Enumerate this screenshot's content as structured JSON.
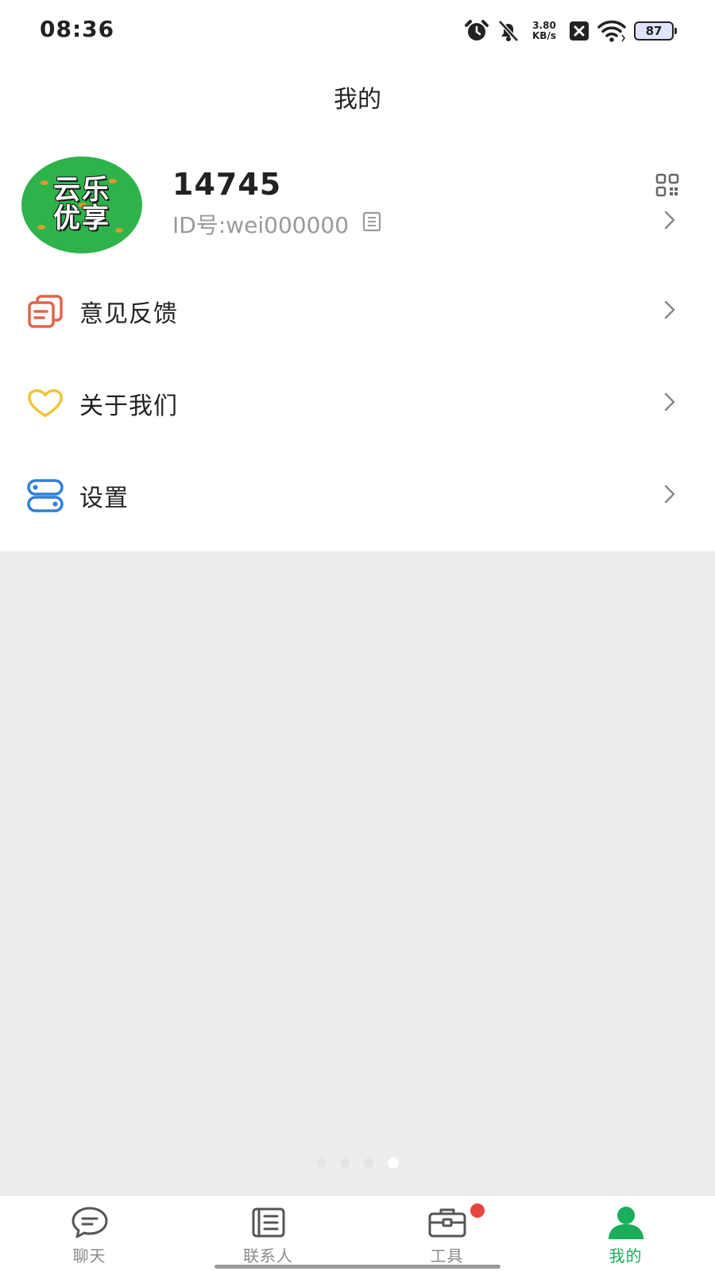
{
  "status_bar": {
    "time": "08:36",
    "net_speed_value": "3.80",
    "net_speed_unit": "KB/s",
    "battery": "87",
    "icons": [
      "alarm-icon",
      "mute-bell-icon",
      "close-box-icon",
      "wifi-icon",
      "battery-icon"
    ]
  },
  "header": {
    "title": "我的"
  },
  "profile": {
    "avatar_text_line1": "云乐",
    "avatar_text_line2": "优享",
    "name": "14745",
    "id_text": "ID号:wei000000",
    "icons": [
      "qr-code-icon",
      "copy-icon",
      "chevron-right-icon"
    ]
  },
  "menu": {
    "items": [
      {
        "label": "意见反馈",
        "icon": "feedback-icon",
        "color": "#e4644a"
      },
      {
        "label": "关于我们",
        "icon": "heart-icon",
        "color": "#f2c12e"
      },
      {
        "label": "设置",
        "icon": "settings-toggle-icon",
        "color": "#2f7fd9"
      }
    ]
  },
  "bottom_nav": {
    "items": [
      {
        "label": "聊天",
        "icon": "chat-icon",
        "active": false
      },
      {
        "label": "联系人",
        "icon": "contacts-icon",
        "active": false
      },
      {
        "label": "工具",
        "icon": "toolbox-icon",
        "active": false,
        "badge": true
      },
      {
        "label": "我的",
        "icon": "person-icon",
        "active": true
      }
    ]
  },
  "page_indicator": {
    "count": 4,
    "active_index": 3
  },
  "colors": {
    "accent": "#1aad5a",
    "background": "#ededed",
    "badge": "#e8453c"
  }
}
